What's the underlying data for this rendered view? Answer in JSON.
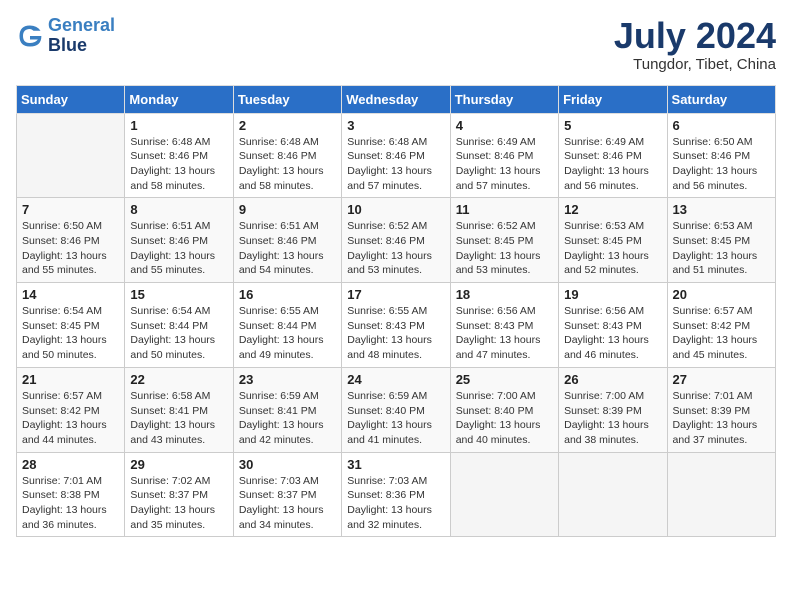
{
  "logo": {
    "line1": "General",
    "line2": "Blue"
  },
  "title": "July 2024",
  "location": "Tungdor, Tibet, China",
  "days_header": [
    "Sunday",
    "Monday",
    "Tuesday",
    "Wednesday",
    "Thursday",
    "Friday",
    "Saturday"
  ],
  "weeks": [
    [
      {
        "num": "",
        "info": ""
      },
      {
        "num": "1",
        "info": "Sunrise: 6:48 AM\nSunset: 8:46 PM\nDaylight: 13 hours\nand 58 minutes."
      },
      {
        "num": "2",
        "info": "Sunrise: 6:48 AM\nSunset: 8:46 PM\nDaylight: 13 hours\nand 58 minutes."
      },
      {
        "num": "3",
        "info": "Sunrise: 6:48 AM\nSunset: 8:46 PM\nDaylight: 13 hours\nand 57 minutes."
      },
      {
        "num": "4",
        "info": "Sunrise: 6:49 AM\nSunset: 8:46 PM\nDaylight: 13 hours\nand 57 minutes."
      },
      {
        "num": "5",
        "info": "Sunrise: 6:49 AM\nSunset: 8:46 PM\nDaylight: 13 hours\nand 56 minutes."
      },
      {
        "num": "6",
        "info": "Sunrise: 6:50 AM\nSunset: 8:46 PM\nDaylight: 13 hours\nand 56 minutes."
      }
    ],
    [
      {
        "num": "7",
        "info": "Sunrise: 6:50 AM\nSunset: 8:46 PM\nDaylight: 13 hours\nand 55 minutes."
      },
      {
        "num": "8",
        "info": "Sunrise: 6:51 AM\nSunset: 8:46 PM\nDaylight: 13 hours\nand 55 minutes."
      },
      {
        "num": "9",
        "info": "Sunrise: 6:51 AM\nSunset: 8:46 PM\nDaylight: 13 hours\nand 54 minutes."
      },
      {
        "num": "10",
        "info": "Sunrise: 6:52 AM\nSunset: 8:46 PM\nDaylight: 13 hours\nand 53 minutes."
      },
      {
        "num": "11",
        "info": "Sunrise: 6:52 AM\nSunset: 8:45 PM\nDaylight: 13 hours\nand 53 minutes."
      },
      {
        "num": "12",
        "info": "Sunrise: 6:53 AM\nSunset: 8:45 PM\nDaylight: 13 hours\nand 52 minutes."
      },
      {
        "num": "13",
        "info": "Sunrise: 6:53 AM\nSunset: 8:45 PM\nDaylight: 13 hours\nand 51 minutes."
      }
    ],
    [
      {
        "num": "14",
        "info": "Sunrise: 6:54 AM\nSunset: 8:45 PM\nDaylight: 13 hours\nand 50 minutes."
      },
      {
        "num": "15",
        "info": "Sunrise: 6:54 AM\nSunset: 8:44 PM\nDaylight: 13 hours\nand 50 minutes."
      },
      {
        "num": "16",
        "info": "Sunrise: 6:55 AM\nSunset: 8:44 PM\nDaylight: 13 hours\nand 49 minutes."
      },
      {
        "num": "17",
        "info": "Sunrise: 6:55 AM\nSunset: 8:43 PM\nDaylight: 13 hours\nand 48 minutes."
      },
      {
        "num": "18",
        "info": "Sunrise: 6:56 AM\nSunset: 8:43 PM\nDaylight: 13 hours\nand 47 minutes."
      },
      {
        "num": "19",
        "info": "Sunrise: 6:56 AM\nSunset: 8:43 PM\nDaylight: 13 hours\nand 46 minutes."
      },
      {
        "num": "20",
        "info": "Sunrise: 6:57 AM\nSunset: 8:42 PM\nDaylight: 13 hours\nand 45 minutes."
      }
    ],
    [
      {
        "num": "21",
        "info": "Sunrise: 6:57 AM\nSunset: 8:42 PM\nDaylight: 13 hours\nand 44 minutes."
      },
      {
        "num": "22",
        "info": "Sunrise: 6:58 AM\nSunset: 8:41 PM\nDaylight: 13 hours\nand 43 minutes."
      },
      {
        "num": "23",
        "info": "Sunrise: 6:59 AM\nSunset: 8:41 PM\nDaylight: 13 hours\nand 42 minutes."
      },
      {
        "num": "24",
        "info": "Sunrise: 6:59 AM\nSunset: 8:40 PM\nDaylight: 13 hours\nand 41 minutes."
      },
      {
        "num": "25",
        "info": "Sunrise: 7:00 AM\nSunset: 8:40 PM\nDaylight: 13 hours\nand 40 minutes."
      },
      {
        "num": "26",
        "info": "Sunrise: 7:00 AM\nSunset: 8:39 PM\nDaylight: 13 hours\nand 38 minutes."
      },
      {
        "num": "27",
        "info": "Sunrise: 7:01 AM\nSunset: 8:39 PM\nDaylight: 13 hours\nand 37 minutes."
      }
    ],
    [
      {
        "num": "28",
        "info": "Sunrise: 7:01 AM\nSunset: 8:38 PM\nDaylight: 13 hours\nand 36 minutes."
      },
      {
        "num": "29",
        "info": "Sunrise: 7:02 AM\nSunset: 8:37 PM\nDaylight: 13 hours\nand 35 minutes."
      },
      {
        "num": "30",
        "info": "Sunrise: 7:03 AM\nSunset: 8:37 PM\nDaylight: 13 hours\nand 34 minutes."
      },
      {
        "num": "31",
        "info": "Sunrise: 7:03 AM\nSunset: 8:36 PM\nDaylight: 13 hours\nand 32 minutes."
      },
      {
        "num": "",
        "info": ""
      },
      {
        "num": "",
        "info": ""
      },
      {
        "num": "",
        "info": ""
      }
    ]
  ]
}
